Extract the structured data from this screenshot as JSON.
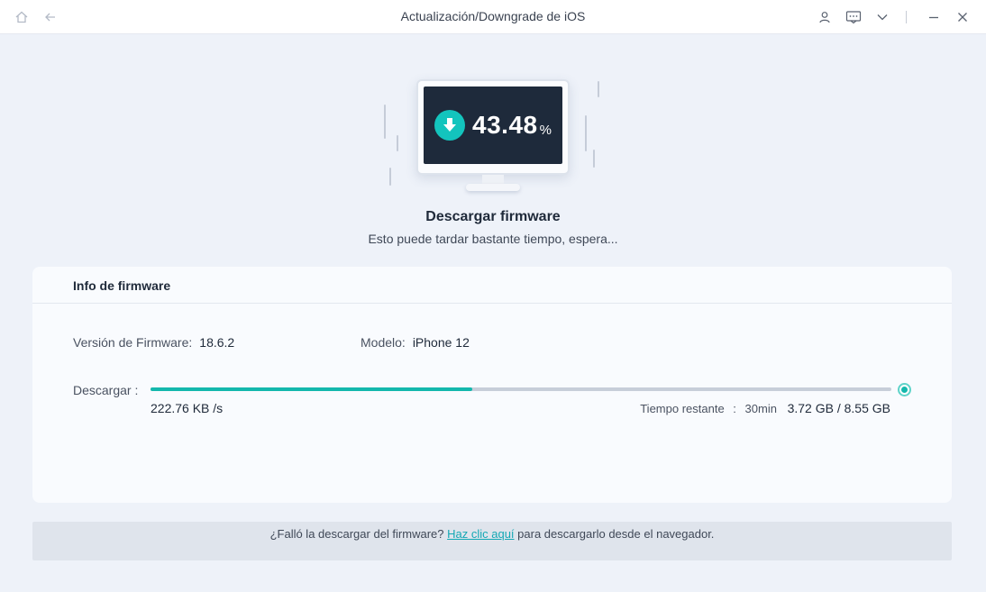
{
  "window": {
    "title": "Actualización/Downgrade de iOS"
  },
  "titlebar": {
    "icons": [
      "home-icon",
      "back-arrow-icon",
      "user-icon",
      "feedback-icon",
      "chevron-down-icon",
      "minimize-icon",
      "close-icon"
    ]
  },
  "download_status": {
    "percent": "43.48",
    "percent_sign": "%",
    "heading": "Descargar firmware",
    "subheading": "Esto puede tardar bastante tiempo, espera..."
  },
  "firmware_card": {
    "title": "Info de firmware",
    "version_label": "Versión de Firmware:",
    "version_value": "18.6.2",
    "model_label": "Modelo:",
    "model_value": "iPhone 12",
    "download_label": "Descargar :",
    "progress_fraction": 0.4348,
    "speed": "222.76 KB /s",
    "remaining_label": "Tiempo restante",
    "remaining_sep": ":",
    "remaining_time": "30min",
    "size": "3.72 GB / 8.55 GB"
  },
  "footer": {
    "text_before": "¿Falló la descargar del firmware?",
    "link": "Haz clic aquí",
    "text_after": "para descargarlo desde el navegador."
  },
  "colors": {
    "accent": "#14b8ad",
    "screen": "#1e2a3b",
    "link": "#14a8b4"
  }
}
